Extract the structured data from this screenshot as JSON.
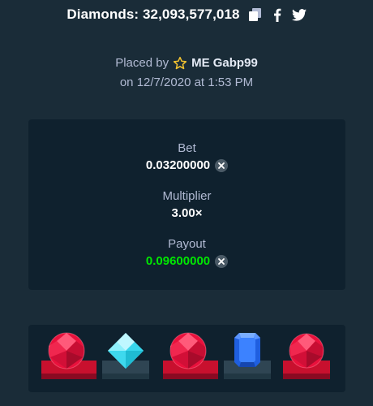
{
  "header": {
    "title": "Diamonds: 32,093,577,018",
    "icons": [
      "copy-icon",
      "facebook-icon",
      "twitter-icon"
    ]
  },
  "placed": {
    "prefix": "Placed by",
    "username": "ME Gabp99",
    "date_line": "on 12/7/2020 at 1:53 PM"
  },
  "details": {
    "bet_label": "Bet",
    "bet_value": "0.03200000",
    "multiplier_label": "Multiplier",
    "multiplier_value": "3.00×",
    "payout_label": "Payout",
    "payout_value": "0.09600000"
  },
  "gems": [
    {
      "type": "ruby",
      "highlighted": true
    },
    {
      "type": "diamond",
      "highlighted": false
    },
    {
      "type": "ruby",
      "highlighted": true
    },
    {
      "type": "sapphire",
      "highlighted": false
    },
    {
      "type": "ruby",
      "highlighted": true
    }
  ],
  "colors": {
    "background": "#1a2c38",
    "panel": "#0f212e",
    "muted_text": "#b1bad3",
    "payout_green": "#00e701",
    "ruby_red": "#e9113c",
    "star_gold": "#f4c430"
  }
}
